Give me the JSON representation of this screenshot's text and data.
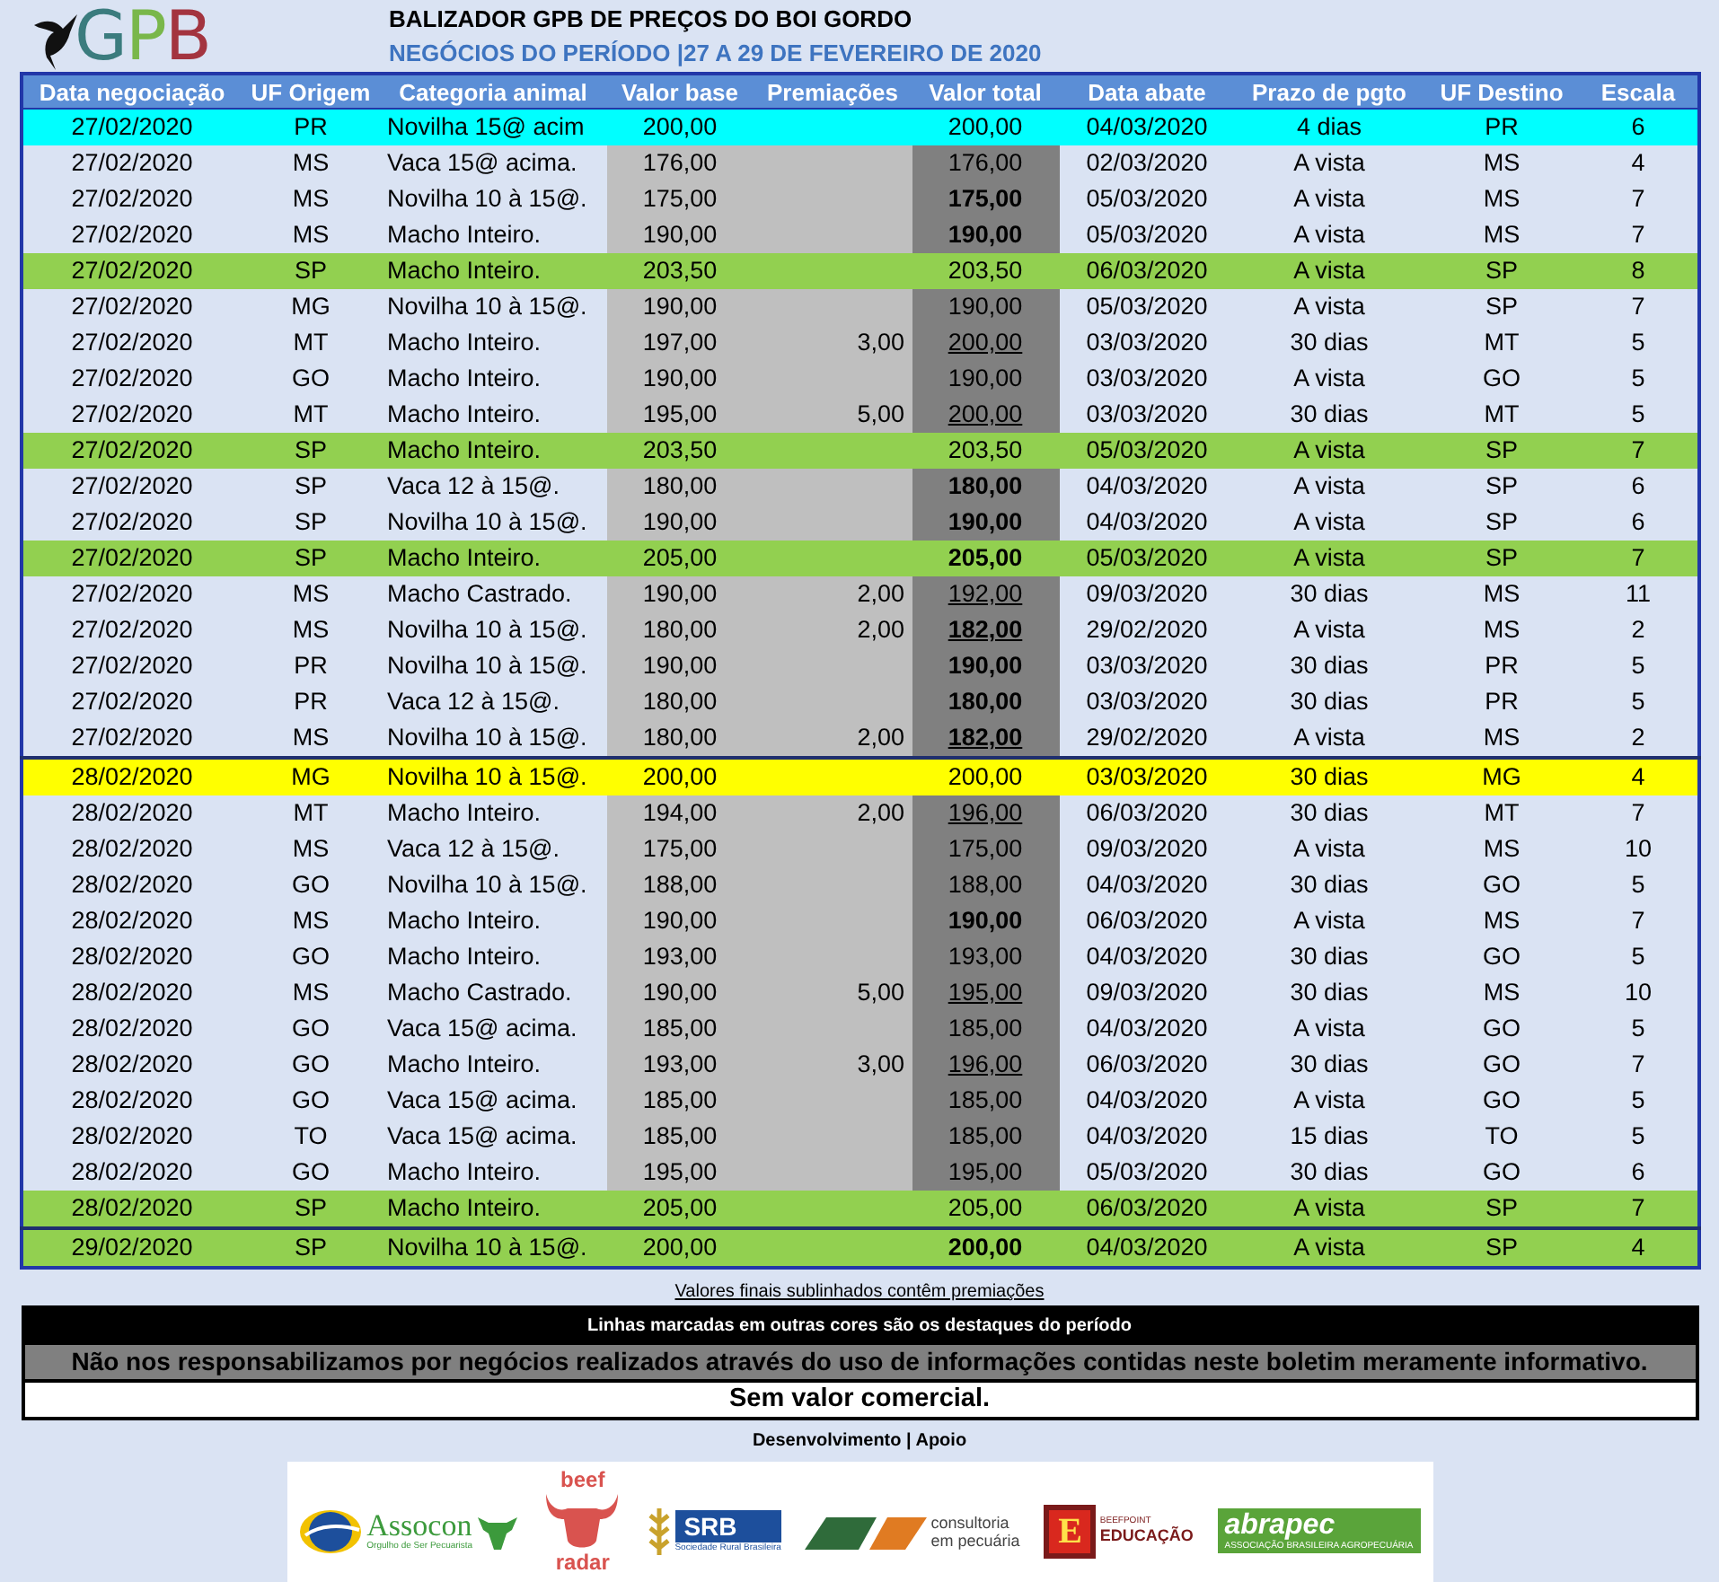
{
  "header": {
    "logo_text": "GPB",
    "title": "BALIZADOR GPB DE PREÇOS DO BOI GORDO",
    "subtitle": "NEGÓCIOS DO PERÍODO |27 A 29 DE FEVEREIRO DE 2020"
  },
  "table": {
    "columns": [
      "Data negociação",
      "UF Origem",
      "Categoria animal",
      "Valor base",
      "Premiações",
      "Valor total",
      "Data abate",
      "Prazo de pgto",
      "UF Destino",
      "Escala"
    ],
    "rows": [
      {
        "cells": [
          "27/02/2020",
          "PR",
          "Novilha 15@ acim",
          "200,00",
          "",
          "200,00",
          "04/03/2020",
          "4 dias",
          "PR",
          "6"
        ],
        "bold": false,
        "underlined": false,
        "divider_above": false,
        "color": "#00ffff"
      },
      {
        "cells": [
          "27/02/2020",
          "MS",
          "Vaca 15@ acima.",
          "176,00",
          "",
          "176,00",
          "02/03/2020",
          "A vista",
          "MS",
          "4"
        ],
        "bold": false,
        "underlined": false,
        "divider_above": false
      },
      {
        "cells": [
          "27/02/2020",
          "MS",
          "Novilha 10 à 15@.",
          "175,00",
          "",
          "175,00",
          "05/03/2020",
          "A vista",
          "MS",
          "7"
        ],
        "bold": true,
        "underlined": false,
        "divider_above": false
      },
      {
        "cells": [
          "27/02/2020",
          "MS",
          "Macho Inteiro.",
          "190,00",
          "",
          "190,00",
          "05/03/2020",
          "A vista",
          "MS",
          "7"
        ],
        "bold": true,
        "underlined": false,
        "divider_above": false
      },
      {
        "cells": [
          "27/02/2020",
          "SP",
          "Macho Inteiro.",
          "203,50",
          "",
          "203,50",
          "06/03/2020",
          "A vista",
          "SP",
          "8"
        ],
        "bold": false,
        "underlined": false,
        "divider_above": false,
        "color": "#92d050"
      },
      {
        "cells": [
          "27/02/2020",
          "MG",
          "Novilha 10 à 15@.",
          "190,00",
          "",
          "190,00",
          "05/03/2020",
          "A vista",
          "SP",
          "7"
        ],
        "bold": false,
        "underlined": false,
        "divider_above": false
      },
      {
        "cells": [
          "27/02/2020",
          "MT",
          "Macho Inteiro.",
          "197,00",
          "3,00",
          "200,00",
          "03/03/2020",
          "30 dias",
          "MT",
          "5"
        ],
        "bold": false,
        "underlined": true,
        "divider_above": false
      },
      {
        "cells": [
          "27/02/2020",
          "GO",
          "Macho Inteiro.",
          "190,00",
          "",
          "190,00",
          "03/03/2020",
          "A vista",
          "GO",
          "5"
        ],
        "bold": false,
        "underlined": false,
        "divider_above": false
      },
      {
        "cells": [
          "27/02/2020",
          "MT",
          "Macho Inteiro.",
          "195,00",
          "5,00",
          "200,00",
          "03/03/2020",
          "30 dias",
          "MT",
          "5"
        ],
        "bold": false,
        "underlined": true,
        "divider_above": false
      },
      {
        "cells": [
          "27/02/2020",
          "SP",
          "Macho Inteiro.",
          "203,50",
          "",
          "203,50",
          "05/03/2020",
          "A vista",
          "SP",
          "7"
        ],
        "bold": false,
        "underlined": false,
        "divider_above": false,
        "color": "#92d050"
      },
      {
        "cells": [
          "27/02/2020",
          "SP",
          "Vaca 12 à 15@.",
          "180,00",
          "",
          "180,00",
          "04/03/2020",
          "A vista",
          "SP",
          "6"
        ],
        "bold": true,
        "underlined": false,
        "divider_above": false
      },
      {
        "cells": [
          "27/02/2020",
          "SP",
          "Novilha 10 à 15@.",
          "190,00",
          "",
          "190,00",
          "04/03/2020",
          "A vista",
          "SP",
          "6"
        ],
        "bold": true,
        "underlined": false,
        "divider_above": false
      },
      {
        "cells": [
          "27/02/2020",
          "SP",
          "Macho Inteiro.",
          "205,00",
          "",
          "205,00",
          "05/03/2020",
          "A vista",
          "SP",
          "7"
        ],
        "bold": true,
        "underlined": false,
        "divider_above": false,
        "color": "#92d050"
      },
      {
        "cells": [
          "27/02/2020",
          "MS",
          "Macho Castrado.",
          "190,00",
          "2,00",
          "192,00",
          "09/03/2020",
          "30 dias",
          "MS",
          "11"
        ],
        "bold": false,
        "underlined": true,
        "divider_above": false
      },
      {
        "cells": [
          "27/02/2020",
          "MS",
          "Novilha 10 à 15@.",
          "180,00",
          "2,00",
          "182,00",
          "29/02/2020",
          "A vista",
          "MS",
          "2"
        ],
        "bold": true,
        "underlined": true,
        "divider_above": false
      },
      {
        "cells": [
          "27/02/2020",
          "PR",
          "Novilha 10 à 15@.",
          "190,00",
          "",
          "190,00",
          "03/03/2020",
          "30 dias",
          "PR",
          "5"
        ],
        "bold": true,
        "underlined": false,
        "divider_above": false
      },
      {
        "cells": [
          "27/02/2020",
          "PR",
          "Vaca 12 à 15@.",
          "180,00",
          "",
          "180,00",
          "03/03/2020",
          "30 dias",
          "PR",
          "5"
        ],
        "bold": true,
        "underlined": false,
        "divider_above": false
      },
      {
        "cells": [
          "27/02/2020",
          "MS",
          "Novilha 10 à 15@.",
          "180,00",
          "2,00",
          "182,00",
          "29/02/2020",
          "A vista",
          "MS",
          "2"
        ],
        "bold": true,
        "underlined": true,
        "divider_above": false
      },
      {
        "cells": [
          "28/02/2020",
          "MG",
          "Novilha 10 à 15@.",
          "200,00",
          "",
          "200,00",
          "03/03/2020",
          "30 dias",
          "MG",
          "4"
        ],
        "bold": false,
        "underlined": false,
        "divider_above": true,
        "color": "#ffff00"
      },
      {
        "cells": [
          "28/02/2020",
          "MT",
          "Macho Inteiro.",
          "194,00",
          "2,00",
          "196,00",
          "06/03/2020",
          "30 dias",
          "MT",
          "7"
        ],
        "bold": false,
        "underlined": true,
        "divider_above": false
      },
      {
        "cells": [
          "28/02/2020",
          "MS",
          "Vaca 12 à 15@.",
          "175,00",
          "",
          "175,00",
          "09/03/2020",
          "A vista",
          "MS",
          "10"
        ],
        "bold": false,
        "underlined": false,
        "divider_above": false
      },
      {
        "cells": [
          "28/02/2020",
          "GO",
          "Novilha 10 à 15@.",
          "188,00",
          "",
          "188,00",
          "04/03/2020",
          "30 dias",
          "GO",
          "5"
        ],
        "bold": false,
        "underlined": false,
        "divider_above": false
      },
      {
        "cells": [
          "28/02/2020",
          "MS",
          "Macho Inteiro.",
          "190,00",
          "",
          "190,00",
          "06/03/2020",
          "A vista",
          "MS",
          "7"
        ],
        "bold": true,
        "underlined": false,
        "divider_above": false
      },
      {
        "cells": [
          "28/02/2020",
          "GO",
          "Macho Inteiro.",
          "193,00",
          "",
          "193,00",
          "04/03/2020",
          "30 dias",
          "GO",
          "5"
        ],
        "bold": false,
        "underlined": false,
        "divider_above": false
      },
      {
        "cells": [
          "28/02/2020",
          "MS",
          "Macho Castrado.",
          "190,00",
          "5,00",
          "195,00",
          "09/03/2020",
          "30 dias",
          "MS",
          "10"
        ],
        "bold": false,
        "underlined": true,
        "divider_above": false
      },
      {
        "cells": [
          "28/02/2020",
          "GO",
          "Vaca 15@ acima.",
          "185,00",
          "",
          "185,00",
          "04/03/2020",
          "A vista",
          "GO",
          "5"
        ],
        "bold": false,
        "underlined": false,
        "divider_above": false
      },
      {
        "cells": [
          "28/02/2020",
          "GO",
          "Macho Inteiro.",
          "193,00",
          "3,00",
          "196,00",
          "06/03/2020",
          "30 dias",
          "GO",
          "7"
        ],
        "bold": false,
        "underlined": true,
        "divider_above": false
      },
      {
        "cells": [
          "28/02/2020",
          "GO",
          "Vaca 15@ acima.",
          "185,00",
          "",
          "185,00",
          "04/03/2020",
          "A vista",
          "GO",
          "5"
        ],
        "bold": false,
        "underlined": false,
        "divider_above": false
      },
      {
        "cells": [
          "28/02/2020",
          "TO",
          "Vaca 15@ acima.",
          "185,00",
          "",
          "185,00",
          "04/03/2020",
          "15 dias",
          "TO",
          "5"
        ],
        "bold": false,
        "underlined": false,
        "divider_above": false
      },
      {
        "cells": [
          "28/02/2020",
          "GO",
          "Macho Inteiro.",
          "195,00",
          "",
          "195,00",
          "05/03/2020",
          "30 dias",
          "GO",
          "6"
        ],
        "bold": false,
        "underlined": false,
        "divider_above": false
      },
      {
        "cells": [
          "28/02/2020",
          "SP",
          "Macho Inteiro.",
          "205,00",
          "",
          "205,00",
          "06/03/2020",
          "A vista",
          "SP",
          "7"
        ],
        "bold": false,
        "underlined": false,
        "divider_above": false,
        "color": "#92d050"
      },
      {
        "cells": [
          "29/02/2020",
          "SP",
          "Novilha 10 à 15@.",
          "200,00",
          "",
          "200,00",
          "04/03/2020",
          "A vista",
          "SP",
          "4"
        ],
        "bold": true,
        "underlined": false,
        "divider_above": true,
        "color": "#92d050"
      }
    ]
  },
  "footer": {
    "note": "Valores finais sublinhados contêm premiações",
    "highlight_note": "Linhas marcadas em outras cores são os destaques do período",
    "disclaimer": "Não nos responsabilizamos por negócios realizados através do uso de informações contidas neste boletim meramente informativo.",
    "no_value": "Sem valor comercial.",
    "credits_label": "Desenvolvimento | Apoio"
  },
  "sponsors": [
    {
      "kind": "assocon",
      "texts": [
        "Assocon",
        "Orgulho de Ser Pecuarista"
      ]
    },
    {
      "kind": "beefradar",
      "texts": [
        "beef",
        "radar"
      ]
    },
    {
      "kind": "srb",
      "texts": [
        "SRB",
        "Sociedade Rural Brasileira"
      ]
    },
    {
      "kind": "z1",
      "texts": [
        "consultoria",
        "em pecuária"
      ]
    },
    {
      "kind": "beefpoint",
      "texts": [
        "E",
        "BEEFPOINT",
        "EDUCAÇÃO"
      ]
    },
    {
      "kind": "abrapec",
      "texts": [
        "abrapec",
        "ASSOCIAÇÃO BRASILEIRA AGROPECUÁRIA"
      ]
    }
  ]
}
